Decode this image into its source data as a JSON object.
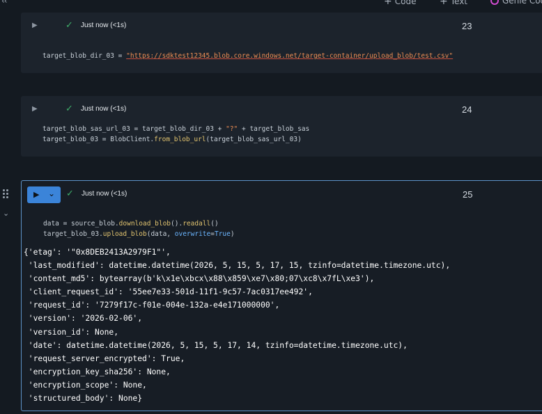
{
  "toolbar": {
    "add_code_label": "Code",
    "add_text_label": "Text",
    "genie_label": "Genie Code"
  },
  "cells": [
    {
      "number": "23",
      "status": "Just now (<1s)",
      "code": {
        "line1_var": "target_blob_dir_03",
        "line1_op": " = ",
        "line1_str": "\"https://sdktest12345.blob.core.windows.net/target-container/upload_blob/test.csv\""
      }
    },
    {
      "number": "24",
      "status": "Just now (<1s)",
      "code": {
        "line1_a": "target_blob_sas_url_03 = target_blob_dir_03 + ",
        "line1_str": "\"?\"",
        "line1_b": " + target_blob_sas",
        "line2_a": "target_blob_03 = BlobClient.",
        "line2_fn": "from_blob_url",
        "line2_b": "(target_blob_sas_url_03)"
      }
    },
    {
      "number": "25",
      "status": "Just now (<1s)",
      "code": {
        "line1_a": "data = source_blob.",
        "line1_fn1": "download_blob",
        "line1_b": "().",
        "line1_fn2": "readall",
        "line1_c": "()",
        "line2_a": "target_blob_03.",
        "line2_fn": "upload_blob",
        "line2_b": "(data, ",
        "line2_kw": "overwrite",
        "line2_c": "=",
        "line2_kw2": "True",
        "line2_d": ")"
      },
      "output": [
        "{'etag': '\"0x8DEB2413A2979F1\"',",
        " 'last_modified': datetime.datetime(2026, 5, 15, 5, 17, 15, tzinfo=datetime.timezone.utc),",
        " 'content_md5': bytearray(b'k\\x1e\\xbcx\\x88\\x859\\xe7\\x80;07\\xc8\\x7fL\\xe3'),",
        " 'client_request_id': '55ee7e33-501d-11f1-9c57-7ac0317ee492',",
        " 'request_id': '7279f17c-f01e-004e-132a-e4e171000000',",
        " 'version': '2026-02-06',",
        " 'version_id': None,",
        " 'date': datetime.datetime(2026, 5, 15, 5, 17, 14, tzinfo=datetime.timezone.utc),",
        " 'request_server_encrypted': True,",
        " 'encryption_key_sha256': None,",
        " 'encryption_scope': None,",
        " 'structured_body': None}"
      ]
    }
  ]
}
